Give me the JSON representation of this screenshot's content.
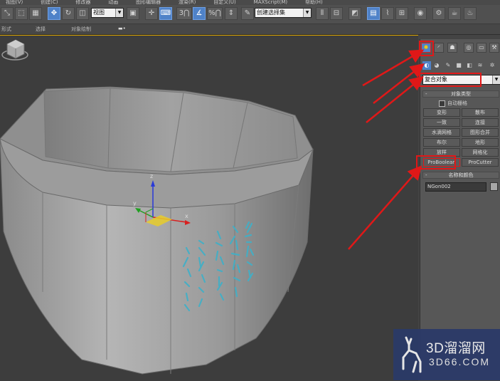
{
  "menu": [
    "视图(V)",
    "创建(C)",
    "修改器",
    "动画",
    "图形编辑器",
    "渲染(R)",
    "自定义(U)",
    "MAXScript(M)",
    "帮助(H)"
  ],
  "toolbar": {
    "view_dropdown": "视图",
    "selection_set": "创建选择集",
    "number_3": "3",
    "percent_label": "%"
  },
  "ribbon": {
    "left": "形式",
    "select": "选择",
    "object_paint": "对象绘制"
  },
  "panel": {
    "category": "复合对象",
    "object_type_title": "对象类型",
    "auto_grid": "自动栅格",
    "buttons": [
      "变形",
      "散布",
      "一致",
      "连接",
      "水滴网格",
      "图形合并",
      "布尔",
      "地形",
      "放样",
      "网格化",
      "ProBoolean",
      "ProCutter"
    ],
    "name_color_title": "名称和颜色",
    "object_name": "NGon002"
  },
  "viewport": {
    "gizmo_axes": [
      "x",
      "y",
      "z"
    ]
  },
  "watermark": {
    "brand": "3D溜溜网",
    "url": "3D66.COM"
  },
  "colors": {
    "accent_blue": "#4f82c8",
    "annotation_red": "#e01818",
    "viewport_bg": "#3d3d3d",
    "calligraphy_cyan": "#3fb0c8"
  }
}
